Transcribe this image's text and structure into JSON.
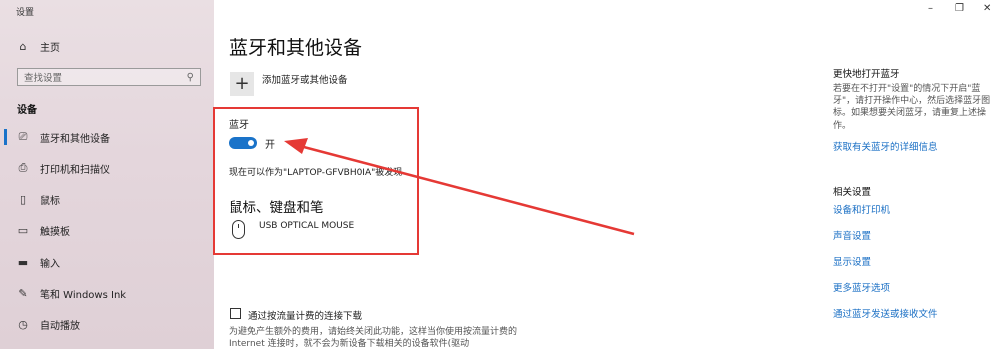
{
  "window": {
    "title": "设置",
    "minimize": "–",
    "maximize": "❐",
    "close": "✕"
  },
  "sidebar": {
    "home": "主页",
    "search_placeholder": "查找设置",
    "section": "设备",
    "items": [
      {
        "label": "蓝牙和其他设备",
        "icon": "bluetooth-device-icon"
      },
      {
        "label": "打印机和扫描仪",
        "icon": "printer-icon"
      },
      {
        "label": "鼠标",
        "icon": "mouse-icon"
      },
      {
        "label": "触摸板",
        "icon": "touchpad-icon"
      },
      {
        "label": "输入",
        "icon": "keyboard-icon"
      },
      {
        "label": "笔和 Windows Ink",
        "icon": "pen-icon"
      },
      {
        "label": "自动播放",
        "icon": "autoplay-icon"
      }
    ]
  },
  "main": {
    "title": "蓝牙和其他设备",
    "add_device": "添加蓝牙或其他设备",
    "bluetooth_label": "蓝牙",
    "toggle_state": "开",
    "toggle_on": true,
    "discoverable": "现在可以作为\"LAPTOP-GFVBH0IA\"被发现",
    "mouse_section": "鼠标、键盘和笔",
    "device_name": "USB OPTICAL MOUSE",
    "metered_label": "通过按流量计费的连接下载",
    "metered_desc": "为避免产生额外的费用，请始终关闭此功能，这样当你使用按流量计费的 Internet 连接时，就不会为新设备下载相关的设备软件(驱动"
  },
  "right": {
    "quick_title": "更快地打开蓝牙",
    "quick_desc": "若要在不打开\"设置\"的情况下开启\"蓝牙\"，请打开操作中心，然后选择蓝牙图标。如果想要关闭蓝牙，请重复上述操作。",
    "quick_link": "获取有关蓝牙的详细信息",
    "related_title": "相关设置",
    "links": [
      "设备和打印机",
      "声音设置",
      "显示设置",
      "更多蓝牙选项",
      "通过蓝牙发送或接收文件"
    ]
  },
  "colors": {
    "accent": "#1a73c9",
    "annotation": "#e53935",
    "link": "#1a6fc4"
  }
}
